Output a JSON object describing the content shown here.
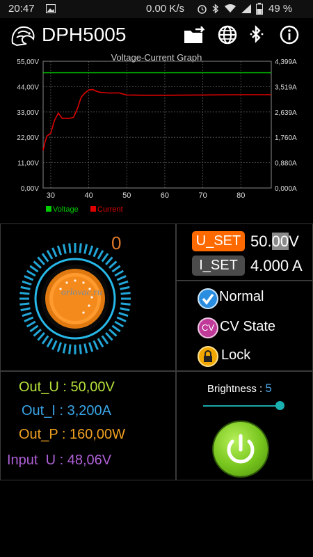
{
  "status_bar": {
    "time": "20:47",
    "net_speed": "0.00 K/s",
    "battery": "49 %"
  },
  "app": {
    "title": "DPH5005"
  },
  "graph": {
    "title": "Voltage-Current Graph"
  },
  "chart_data": {
    "type": "line",
    "title": "Voltage-Current Graph",
    "x": {
      "min": 28,
      "max": 88,
      "ticks": [
        30,
        40,
        50,
        60,
        70,
        80
      ]
    },
    "y_left": {
      "min": 0,
      "max": 55,
      "labels": [
        "55,00V",
        "44,00V",
        "33,00V",
        "22,00V",
        "11,00V",
        "0,00V"
      ],
      "values": [
        55,
        44,
        33,
        22,
        11,
        0
      ]
    },
    "y_right": {
      "min": 0,
      "max": 4.399,
      "labels": [
        "4,399A",
        "3,519A",
        "2,639A",
        "1,760A",
        "0,880A",
        "0,000A"
      ]
    },
    "grid": true,
    "legend": {
      "position": "bottom-left",
      "items": [
        {
          "name": "Voltage",
          "color": "#00cc00"
        },
        {
          "name": "Current",
          "color": "#e00000"
        }
      ]
    },
    "series": [
      {
        "name": "Voltage",
        "color": "#00cc00",
        "points": [
          [
            28,
            50
          ],
          [
            88,
            50
          ]
        ]
      },
      {
        "name": "Current",
        "color": "#e00000",
        "points": [
          [
            28,
            1.3
          ],
          [
            28.5,
            1.6
          ],
          [
            29,
            1.8
          ],
          [
            30,
            1.9
          ],
          [
            31,
            2.35
          ],
          [
            32,
            2.6
          ],
          [
            33,
            2.42
          ],
          [
            34,
            2.42
          ],
          [
            35,
            2.42
          ],
          [
            36,
            2.45
          ],
          [
            37,
            2.75
          ],
          [
            38,
            3.15
          ],
          [
            39,
            3.3
          ],
          [
            40,
            3.4
          ],
          [
            41,
            3.42
          ],
          [
            42,
            3.36
          ],
          [
            43,
            3.32
          ],
          [
            45,
            3.3
          ],
          [
            48,
            3.3
          ],
          [
            50,
            3.23
          ],
          [
            55,
            3.22
          ],
          [
            60,
            3.22
          ],
          [
            70,
            3.23
          ],
          [
            80,
            3.24
          ],
          [
            88,
            3.24
          ]
        ]
      }
    ]
  },
  "knob": {
    "value": "0",
    "watermark": "orlovac.ru"
  },
  "settings": {
    "u_set_label": "U_SET",
    "u_set_value_pre": "50.",
    "u_set_value_sel": "00",
    "u_set_unit": "V",
    "i_set_label": "I_SET",
    "i_set_value": "4.000 A"
  },
  "modes": {
    "normal": "Normal",
    "cv_icon": "CV",
    "cv_state": "CV State",
    "lock": "Lock"
  },
  "readings": {
    "out_u": "Out_U : 50,00V",
    "out_i": "Out_I : 3,200A",
    "out_p": "Out_P : 160,00W",
    "input_u": "Input  U : 48,06V"
  },
  "brightness": {
    "label": "Brightness : ",
    "value": "5",
    "level": 1.0
  },
  "colors": {
    "out_u": "#b6e33a",
    "out_i": "#3aa6e8",
    "out_p": "#f0a020",
    "input_u": "#b060d8",
    "accent": "#ff6a00"
  }
}
